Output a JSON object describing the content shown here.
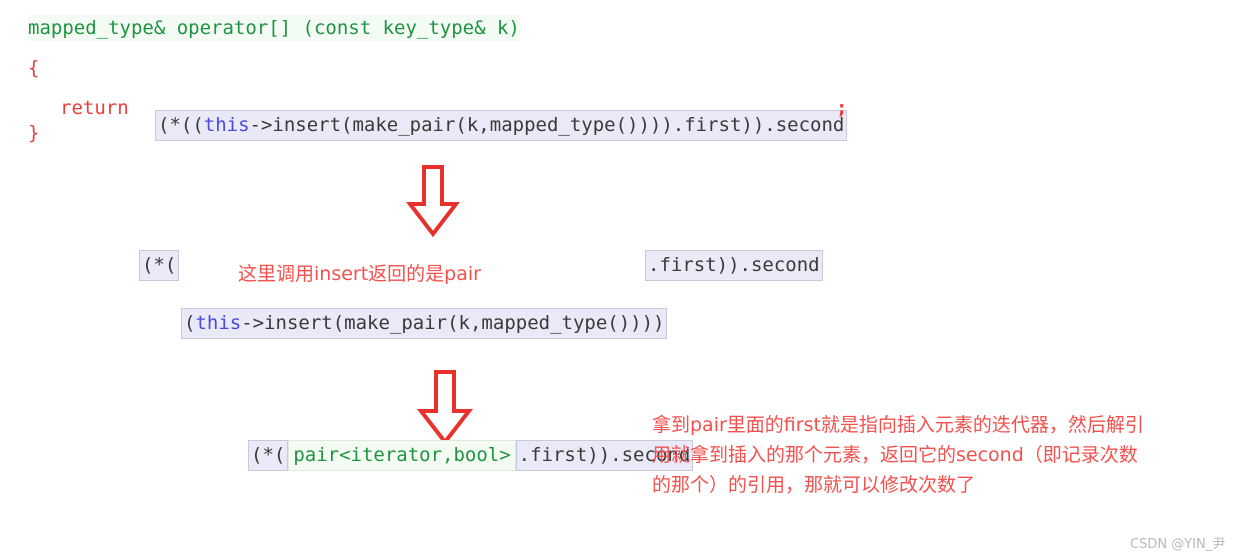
{
  "code_block": {
    "signature": "mapped_type& operator[] (const key_type& k)",
    "open_brace": "{",
    "close_brace": "}",
    "return_keyword": "return",
    "expression_prefix": "(*((",
    "expression_this": "this",
    "expression_rest": "->insert(make_pair(k,mapped_type()))).first)).second",
    "semicolon": ";"
  },
  "step_two": {
    "left_fragment": "(*(",
    "right_fragment": ".first)).second",
    "note": "这里调用insert返回的是pair",
    "inner_open": "(",
    "inner_this": "this",
    "inner_rest": "->insert(make_pair(k,mapped_type())))"
  },
  "step_three": {
    "left_fragment": "(*(",
    "type_fragment": "pair<iterator,bool>",
    "right_fragment": ".first)).second",
    "note": "拿到pair里面的first就是指向插入元素的迭代器，然后解引用就拿到插入的那个元素，返回它的second（即记录次数的那个）的引用，那就可以修改次数了"
  },
  "arrows": {
    "first_label": "down-arrow-step-1",
    "second_label": "down-arrow-step-2",
    "color": "#e8302c"
  },
  "watermark": {
    "text": "CSDN @YIN_尹"
  },
  "colors": {
    "background": "#ffffff",
    "code_green": "#1f9440",
    "code_red": "#e8413c",
    "note_red": "#f4514e",
    "chip_bg": "#e9e9f7",
    "chip_border": "#c9c9dd",
    "this_blue": "#4a4ae0",
    "watermark_gray": "#b9b9b9"
  }
}
